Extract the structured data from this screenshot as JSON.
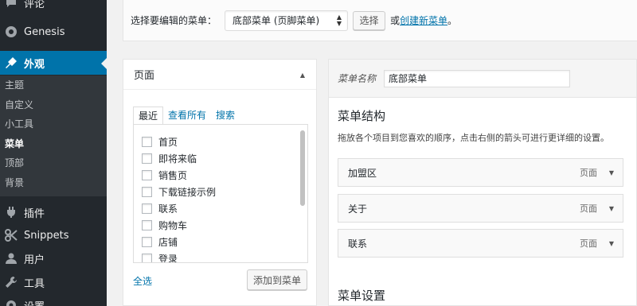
{
  "sidebar": {
    "items": [
      {
        "label": "评论",
        "icon": "comments-icon"
      },
      {
        "label": "Genesis",
        "icon": "genesis-icon"
      },
      {
        "label": "外观",
        "icon": "appearance-icon"
      },
      {
        "label": "插件",
        "icon": "plugins-icon"
      },
      {
        "label": "Snippets",
        "icon": "snippets-icon"
      },
      {
        "label": "用户",
        "icon": "users-icon"
      },
      {
        "label": "工具",
        "icon": "tools-icon"
      },
      {
        "label": "设置",
        "icon": "settings-icon"
      }
    ],
    "submenu": [
      "主题",
      "自定义",
      "小工具",
      "菜单",
      "顶部",
      "背景"
    ],
    "current_submenu": "菜单"
  },
  "topbar": {
    "select_label": "选择要编辑的菜单：",
    "select_value": "底部菜单 (页脚菜单)",
    "select_button": "选择",
    "or_text": "或",
    "create_link": "创建新菜单",
    "period": "。"
  },
  "pages_panel": {
    "title": "页面",
    "tabs": [
      "最近",
      "查看所有",
      "搜索"
    ],
    "active_tab": "最近",
    "items": [
      "首页",
      "即将来临",
      "销售页",
      "下载链接示例",
      "联系",
      "购物车",
      "店铺",
      "登录"
    ],
    "select_all": "全选",
    "add_button": "添加到菜单"
  },
  "menu_editor": {
    "name_label": "菜单名称",
    "name_value": "底部菜单",
    "structure_title": "菜单结构",
    "structure_desc": "拖放各个项目到您喜欢的顺序，点击右侧的箭头可进行更详细的设置。",
    "items": [
      {
        "label": "加盟区",
        "type": "页面"
      },
      {
        "label": "关于",
        "type": "页面"
      },
      {
        "label": "联系",
        "type": "页面"
      }
    ],
    "settings_title": "菜单设置"
  },
  "colors": {
    "accent": "#0073aa",
    "sidebar_bg": "#23282d",
    "submenu_bg": "#32373c"
  }
}
